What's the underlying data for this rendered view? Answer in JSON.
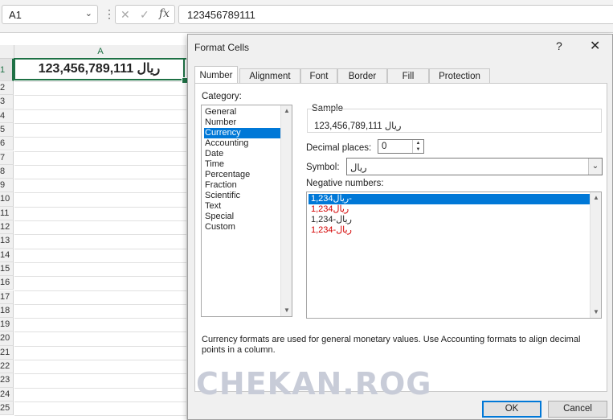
{
  "formula_bar": {
    "name_box": "A1",
    "name_box_arrow": "⌄",
    "dots": "⋮",
    "cancel_icon": "✕",
    "enter_icon": "✓",
    "fx_label": "fx",
    "formula": "123456789111"
  },
  "sheet": {
    "column_header": "A",
    "row_numbers": [
      "1",
      "2",
      "3",
      "4",
      "5",
      "6",
      "7",
      "8",
      "9",
      "10",
      "11",
      "12",
      "13",
      "14",
      "15",
      "16",
      "17",
      "18",
      "19",
      "20",
      "21",
      "22",
      "23",
      "24",
      "25"
    ],
    "cell_a1": "123,456,789,111 ریال",
    "accent": "#1e7145"
  },
  "dialog": {
    "title": "Format Cells",
    "help": "?",
    "close": "✕",
    "tabs": [
      "Number",
      "Alignment",
      "Font",
      "Border",
      "Fill",
      "Protection"
    ],
    "category_label": "Category:",
    "categories": [
      "General",
      "Number",
      "Currency",
      "Accounting",
      "Date",
      "Time",
      "Percentage",
      "Fraction",
      "Scientific",
      "Text",
      "Special",
      "Custom"
    ],
    "selected_category": "Currency",
    "sample_label": "Sample",
    "sample_value": "123,456,789,111 ریال",
    "decimal_places_label": "Decimal places:",
    "decimal_places_value": "0",
    "symbol_label": "Symbol:",
    "symbol_value": "ریال",
    "negative_numbers_label": "Negative numbers:",
    "negative_numbers": [
      "‏-ریال1,234",
      "ریال1,234",
      "ریال-1,234",
      "ریال-1,234"
    ],
    "description": "Currency formats are used for general monetary values.  Use Accounting formats to align decimal points in a column.",
    "ok": "OK",
    "cancel": "Cancel",
    "selection_color": "#0078d7",
    "negative_red": "#d40000"
  },
  "watermark": "CHEKAN.ROG"
}
